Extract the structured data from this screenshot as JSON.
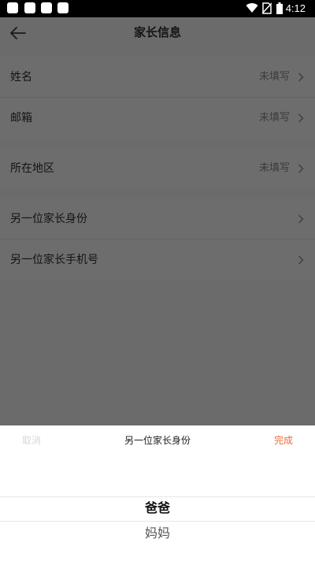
{
  "status_bar": {
    "time": "4:12",
    "notification_icons": [
      "app-icon",
      "app-icon",
      "app-icon",
      "app-icon"
    ],
    "icons": [
      "wifi-icon",
      "no-sim-icon",
      "battery-icon"
    ]
  },
  "header": {
    "title": "家长信息",
    "back_icon": "arrow-left-icon"
  },
  "groups": [
    {
      "rows": [
        {
          "label": "姓名",
          "value": "未填写"
        },
        {
          "label": "邮箱",
          "value": "未填写"
        }
      ]
    },
    {
      "rows": [
        {
          "label": "所在地区",
          "value": "未填写"
        }
      ]
    },
    {
      "rows": [
        {
          "label": "另一位家长身份",
          "value": ""
        },
        {
          "label": "另一位家长手机号",
          "value": ""
        }
      ]
    }
  ],
  "picker": {
    "cancel_label": "取消",
    "title": "另一位家长身份",
    "done_label": "完成",
    "options": [
      "爸爸",
      "妈妈"
    ],
    "selected": "爸爸"
  },
  "colors": {
    "accent": "#f26a34",
    "overlay_background": "#6b6b6b",
    "sheet_background": "#ffffff"
  }
}
